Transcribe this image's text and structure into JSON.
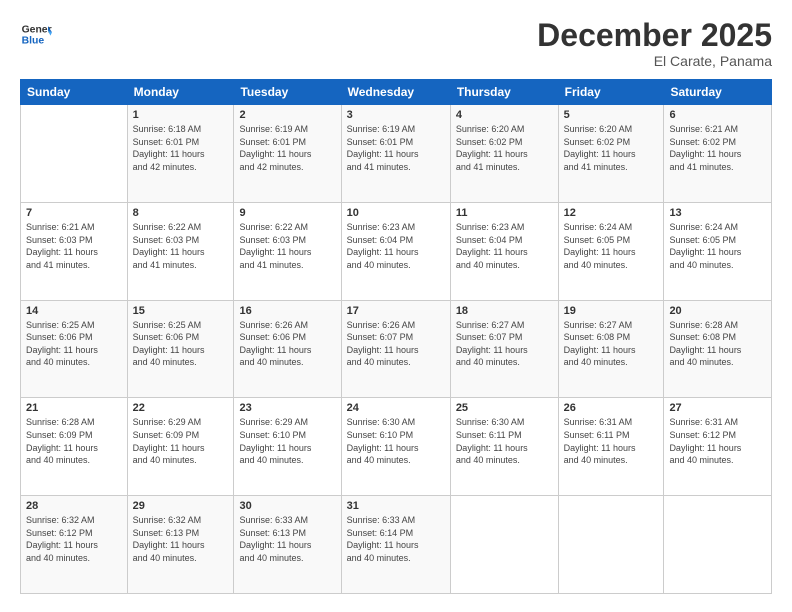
{
  "header": {
    "logo_line1": "General",
    "logo_line2": "Blue",
    "month": "December 2025",
    "location": "El Carate, Panama"
  },
  "weekdays": [
    "Sunday",
    "Monday",
    "Tuesday",
    "Wednesday",
    "Thursday",
    "Friday",
    "Saturday"
  ],
  "weeks": [
    [
      {
        "day": "",
        "info": ""
      },
      {
        "day": "1",
        "info": "Sunrise: 6:18 AM\nSunset: 6:01 PM\nDaylight: 11 hours\nand 42 minutes."
      },
      {
        "day": "2",
        "info": "Sunrise: 6:19 AM\nSunset: 6:01 PM\nDaylight: 11 hours\nand 42 minutes."
      },
      {
        "day": "3",
        "info": "Sunrise: 6:19 AM\nSunset: 6:01 PM\nDaylight: 11 hours\nand 41 minutes."
      },
      {
        "day": "4",
        "info": "Sunrise: 6:20 AM\nSunset: 6:02 PM\nDaylight: 11 hours\nand 41 minutes."
      },
      {
        "day": "5",
        "info": "Sunrise: 6:20 AM\nSunset: 6:02 PM\nDaylight: 11 hours\nand 41 minutes."
      },
      {
        "day": "6",
        "info": "Sunrise: 6:21 AM\nSunset: 6:02 PM\nDaylight: 11 hours\nand 41 minutes."
      }
    ],
    [
      {
        "day": "7",
        "info": "Sunrise: 6:21 AM\nSunset: 6:03 PM\nDaylight: 11 hours\nand 41 minutes."
      },
      {
        "day": "8",
        "info": "Sunrise: 6:22 AM\nSunset: 6:03 PM\nDaylight: 11 hours\nand 41 minutes."
      },
      {
        "day": "9",
        "info": "Sunrise: 6:22 AM\nSunset: 6:03 PM\nDaylight: 11 hours\nand 41 minutes."
      },
      {
        "day": "10",
        "info": "Sunrise: 6:23 AM\nSunset: 6:04 PM\nDaylight: 11 hours\nand 40 minutes."
      },
      {
        "day": "11",
        "info": "Sunrise: 6:23 AM\nSunset: 6:04 PM\nDaylight: 11 hours\nand 40 minutes."
      },
      {
        "day": "12",
        "info": "Sunrise: 6:24 AM\nSunset: 6:05 PM\nDaylight: 11 hours\nand 40 minutes."
      },
      {
        "day": "13",
        "info": "Sunrise: 6:24 AM\nSunset: 6:05 PM\nDaylight: 11 hours\nand 40 minutes."
      }
    ],
    [
      {
        "day": "14",
        "info": "Sunrise: 6:25 AM\nSunset: 6:06 PM\nDaylight: 11 hours\nand 40 minutes."
      },
      {
        "day": "15",
        "info": "Sunrise: 6:25 AM\nSunset: 6:06 PM\nDaylight: 11 hours\nand 40 minutes."
      },
      {
        "day": "16",
        "info": "Sunrise: 6:26 AM\nSunset: 6:06 PM\nDaylight: 11 hours\nand 40 minutes."
      },
      {
        "day": "17",
        "info": "Sunrise: 6:26 AM\nSunset: 6:07 PM\nDaylight: 11 hours\nand 40 minutes."
      },
      {
        "day": "18",
        "info": "Sunrise: 6:27 AM\nSunset: 6:07 PM\nDaylight: 11 hours\nand 40 minutes."
      },
      {
        "day": "19",
        "info": "Sunrise: 6:27 AM\nSunset: 6:08 PM\nDaylight: 11 hours\nand 40 minutes."
      },
      {
        "day": "20",
        "info": "Sunrise: 6:28 AM\nSunset: 6:08 PM\nDaylight: 11 hours\nand 40 minutes."
      }
    ],
    [
      {
        "day": "21",
        "info": "Sunrise: 6:28 AM\nSunset: 6:09 PM\nDaylight: 11 hours\nand 40 minutes."
      },
      {
        "day": "22",
        "info": "Sunrise: 6:29 AM\nSunset: 6:09 PM\nDaylight: 11 hours\nand 40 minutes."
      },
      {
        "day": "23",
        "info": "Sunrise: 6:29 AM\nSunset: 6:10 PM\nDaylight: 11 hours\nand 40 minutes."
      },
      {
        "day": "24",
        "info": "Sunrise: 6:30 AM\nSunset: 6:10 PM\nDaylight: 11 hours\nand 40 minutes."
      },
      {
        "day": "25",
        "info": "Sunrise: 6:30 AM\nSunset: 6:11 PM\nDaylight: 11 hours\nand 40 minutes."
      },
      {
        "day": "26",
        "info": "Sunrise: 6:31 AM\nSunset: 6:11 PM\nDaylight: 11 hours\nand 40 minutes."
      },
      {
        "day": "27",
        "info": "Sunrise: 6:31 AM\nSunset: 6:12 PM\nDaylight: 11 hours\nand 40 minutes."
      }
    ],
    [
      {
        "day": "28",
        "info": "Sunrise: 6:32 AM\nSunset: 6:12 PM\nDaylight: 11 hours\nand 40 minutes."
      },
      {
        "day": "29",
        "info": "Sunrise: 6:32 AM\nSunset: 6:13 PM\nDaylight: 11 hours\nand 40 minutes."
      },
      {
        "day": "30",
        "info": "Sunrise: 6:33 AM\nSunset: 6:13 PM\nDaylight: 11 hours\nand 40 minutes."
      },
      {
        "day": "31",
        "info": "Sunrise: 6:33 AM\nSunset: 6:14 PM\nDaylight: 11 hours\nand 40 minutes."
      },
      {
        "day": "",
        "info": ""
      },
      {
        "day": "",
        "info": ""
      },
      {
        "day": "",
        "info": ""
      }
    ]
  ]
}
